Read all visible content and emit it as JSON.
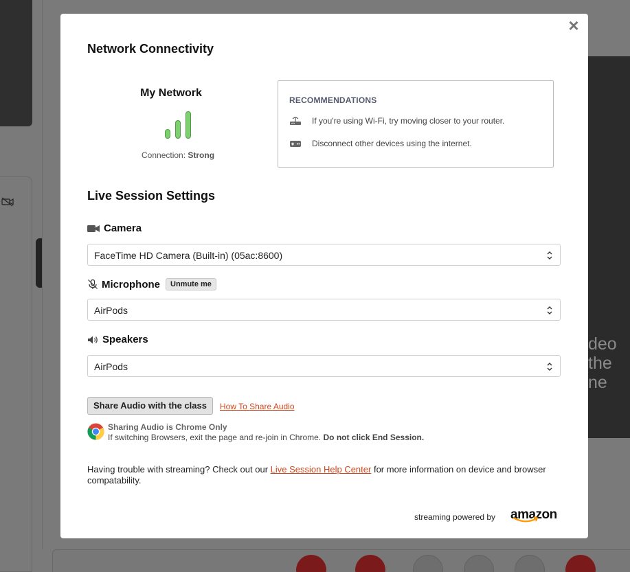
{
  "modal": {
    "close_label": "×",
    "network": {
      "title": "Network Connectivity",
      "my_network_label": "My Network",
      "signal_bars": 3,
      "signal_bars_max": 3,
      "connection_label": "Connection:",
      "connection_value": "Strong",
      "signal_color": "#7ecf6f"
    },
    "recommendations": {
      "heading": "RECOMMENDATIONS",
      "items": [
        {
          "icon": "router-icon",
          "text": "If you're using Wi-Fi, try moving closer to your router."
        },
        {
          "icon": "devices-icon",
          "text": "Disconnect other devices using the internet."
        }
      ]
    },
    "live_settings": {
      "title": "Live Session Settings",
      "camera": {
        "icon": "camera-icon",
        "label": "Camera",
        "value": "FaceTime HD Camera (Built-in) (05ac:8600)"
      },
      "microphone": {
        "icon": "microphone-muted-icon",
        "label": "Microphone",
        "unmute_label": "Unmute me",
        "value": "AirPods"
      },
      "speakers": {
        "icon": "speaker-icon",
        "label": "Speakers",
        "value": "AirPods"
      }
    },
    "share_audio": {
      "button_label": "Share Audio with the class",
      "link_label": "How To Share Audio",
      "chrome_title": "Sharing Audio is Chrome Only",
      "chrome_sub": "If switching Browsers, exit the page and re-join in Chrome.",
      "chrome_warning": "Do not click End Session."
    },
    "help": {
      "before": "Having trouble with streaming? Check out our ",
      "link": "Live Session Help Center",
      "after": " for more information on device and browser compatability."
    },
    "footer": {
      "powered_label": "streaming powered by",
      "brand": "amazon"
    },
    "accent_color": "#d1461f"
  },
  "background": {
    "video_text": [
      "deo",
      "the",
      "ne"
    ]
  }
}
